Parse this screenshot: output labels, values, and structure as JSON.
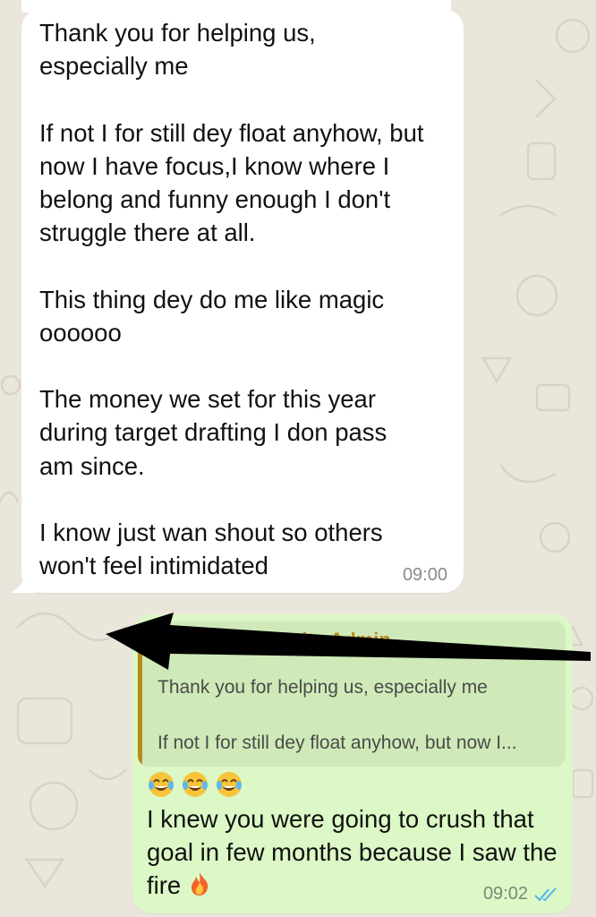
{
  "incoming": {
    "text": "Thank you for helping us,\nespecially me\n\nIf not I for still dey float anyhow, but\nnow I have focus,I know where I\nbelong and funny enough I don't\nstruggle there at all.\n\nThis thing dey do me like magic\noooooo\n\nThe money we set for this year\nduring target drafting I don pass\nam since.\n\nI know just wan shout so others\nwon't feel intimidated",
    "time": "09:00"
  },
  "outgoing": {
    "quote": {
      "author": "Forex Community Admin",
      "text": "Thank you for helping us, especially me\n\nIf not I for still dey float anyhow, but now I..."
    },
    "emojis": [
      "tears-of-joy",
      "tears-of-joy",
      "tears-of-joy"
    ],
    "text": "I knew you were going to crush that goal in few months because I saw the fire",
    "trailing_emoji": "fire",
    "time": "09:02",
    "status": "read"
  },
  "colors": {
    "wallpaper": "#ebe6dc",
    "incoming_bubble": "#ffffff",
    "outgoing_bubble": "#dcf8c6",
    "quote_accent": "#b88a1e",
    "read_ticks": "#4fb6ec",
    "arrow": "#000000"
  }
}
